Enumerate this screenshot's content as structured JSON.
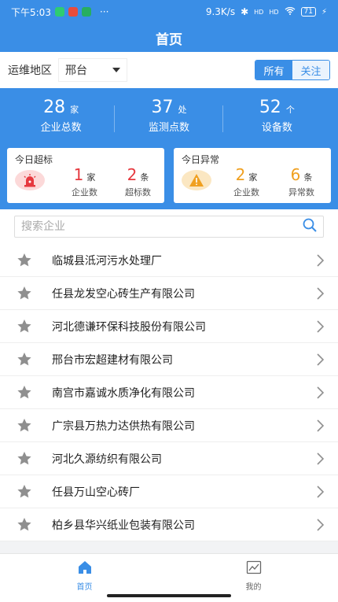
{
  "statusbar": {
    "time": "下午5:03",
    "dots": "···",
    "speed": "9.3K/s",
    "bt": "✱",
    "signal1": "HD",
    "signal2": "HD",
    "battery": "71",
    "charge": "⚡"
  },
  "header": {
    "title": "首页"
  },
  "filter": {
    "label": "运维地区",
    "region": "邢台",
    "seg_all": "所有",
    "seg_follow": "关注"
  },
  "stats": [
    {
      "value": "28",
      "unit": "家",
      "label": "企业总数"
    },
    {
      "value": "37",
      "unit": "处",
      "label": "监测点数"
    },
    {
      "value": "52",
      "unit": "个",
      "label": "设备数"
    }
  ],
  "cards": {
    "overlimit": {
      "title": "今日超标",
      "a_value": "1",
      "a_unit": "家",
      "a_label": "企业数",
      "b_value": "2",
      "b_unit": "条",
      "b_label": "超标数"
    },
    "abnormal": {
      "title": "今日异常",
      "a_value": "2",
      "a_unit": "家",
      "a_label": "企业数",
      "b_value": "6",
      "b_unit": "条",
      "b_label": "异常数"
    }
  },
  "search": {
    "placeholder": "搜索企业"
  },
  "companies": [
    "临城县泜河污水处理厂",
    "任县龙发空心砖生产有限公司",
    "河北德谦环保科技股份有限公司",
    "邢台市宏超建材有限公司",
    "南宫市嘉诚水质净化有限公司",
    "广宗县万热力达供热有限公司",
    "河北久源纺织有限公司",
    "任县万山空心砖厂",
    "柏乡县华兴纸业包装有限公司"
  ],
  "tabs": {
    "home": "首页",
    "mine": "我的"
  },
  "colors": {
    "primary": "#3a8ee6",
    "danger": "#e6393f",
    "warning": "#f0a020"
  }
}
